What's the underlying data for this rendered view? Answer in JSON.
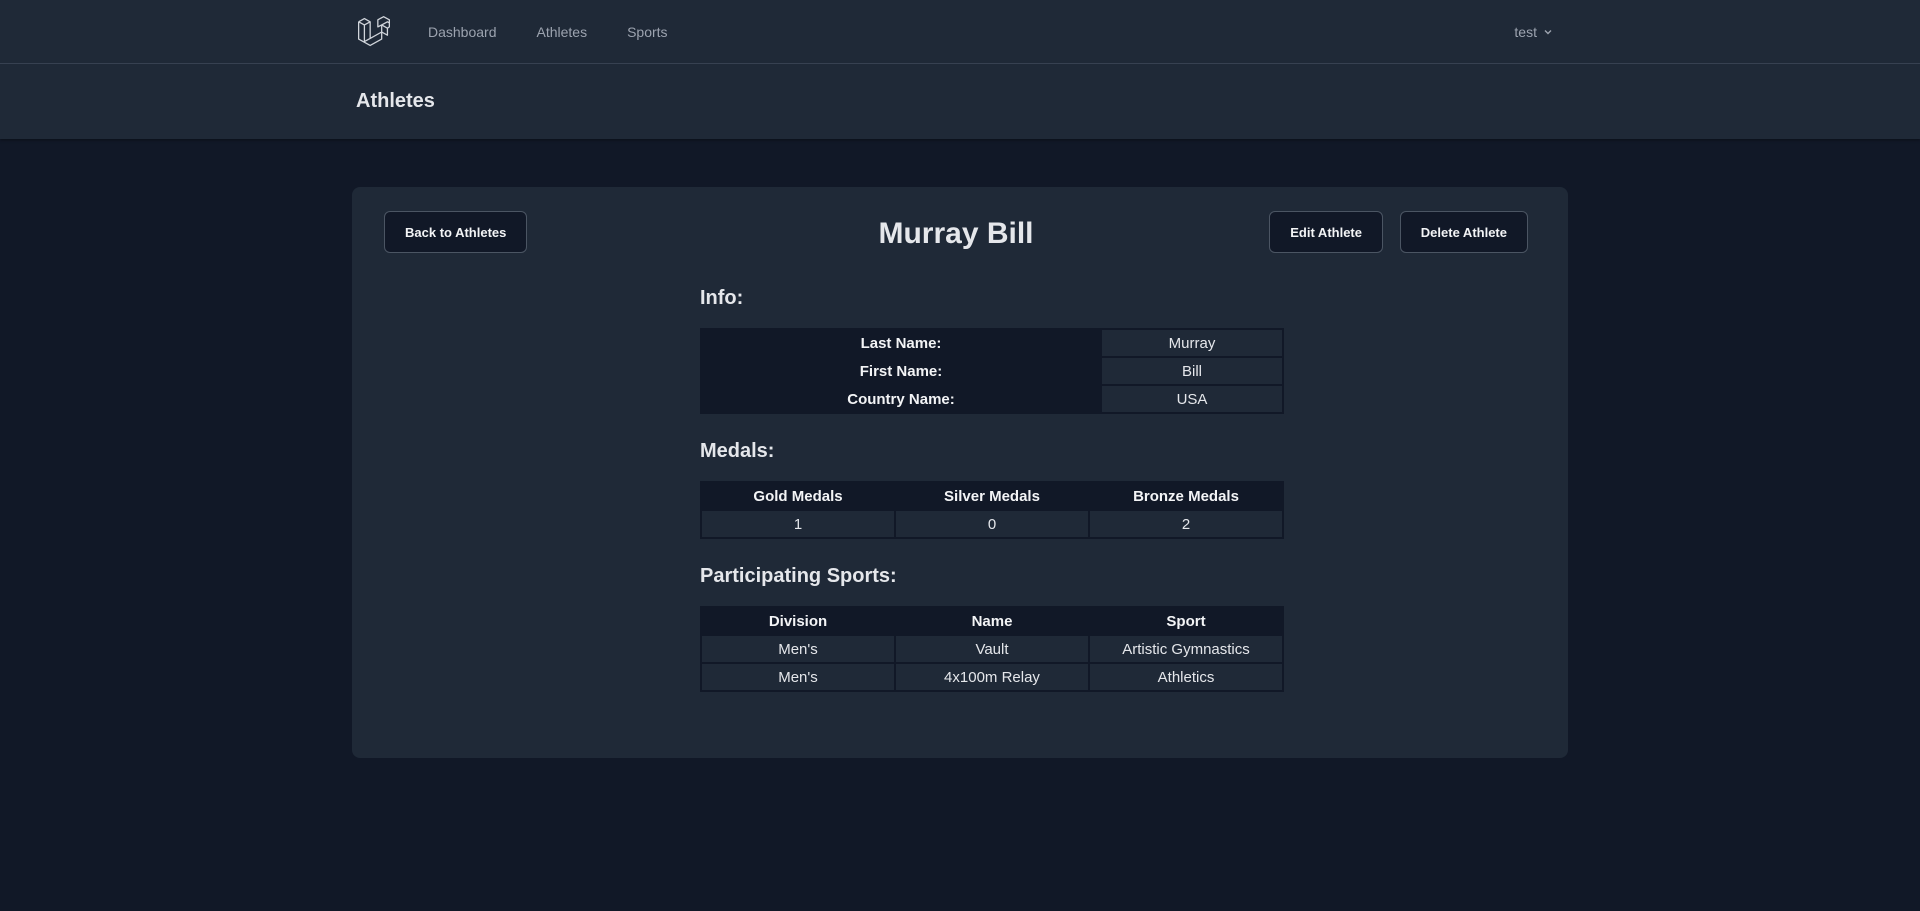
{
  "nav": {
    "logo_icon": "laravel-logo-icon",
    "links": [
      {
        "label": "Dashboard"
      },
      {
        "label": "Athletes"
      },
      {
        "label": "Sports"
      }
    ],
    "user": {
      "name": "test",
      "icon": "chevron-down-icon"
    }
  },
  "header": {
    "title": "Athletes"
  },
  "card": {
    "back_label": "Back to Athletes",
    "edit_label": "Edit Athlete",
    "delete_label": "Delete Athlete",
    "athlete_name": "Murray Bill"
  },
  "info": {
    "title": "Info:",
    "rows": [
      {
        "label": "Last Name:",
        "value": "Murray"
      },
      {
        "label": "First Name:",
        "value": "Bill"
      },
      {
        "label": "Country Name:",
        "value": "USA"
      }
    ]
  },
  "medals": {
    "title": "Medals:",
    "headers": [
      "Gold Medals",
      "Silver Medals",
      "Bronze Medals"
    ],
    "values": [
      "1",
      "0",
      "2"
    ]
  },
  "sports": {
    "title": "Participating Sports:",
    "headers": [
      "Division",
      "Name",
      "Sport"
    ],
    "rows": [
      [
        "Men's",
        "Vault",
        "Artistic Gymnastics"
      ],
      [
        "Men's",
        "4x100m Relay",
        "Athletics"
      ]
    ]
  },
  "colors": {
    "background": "#111827",
    "panel": "#1f2937",
    "border": "#374151",
    "text": "#e5e7eb",
    "muted": "#9ca3af"
  }
}
